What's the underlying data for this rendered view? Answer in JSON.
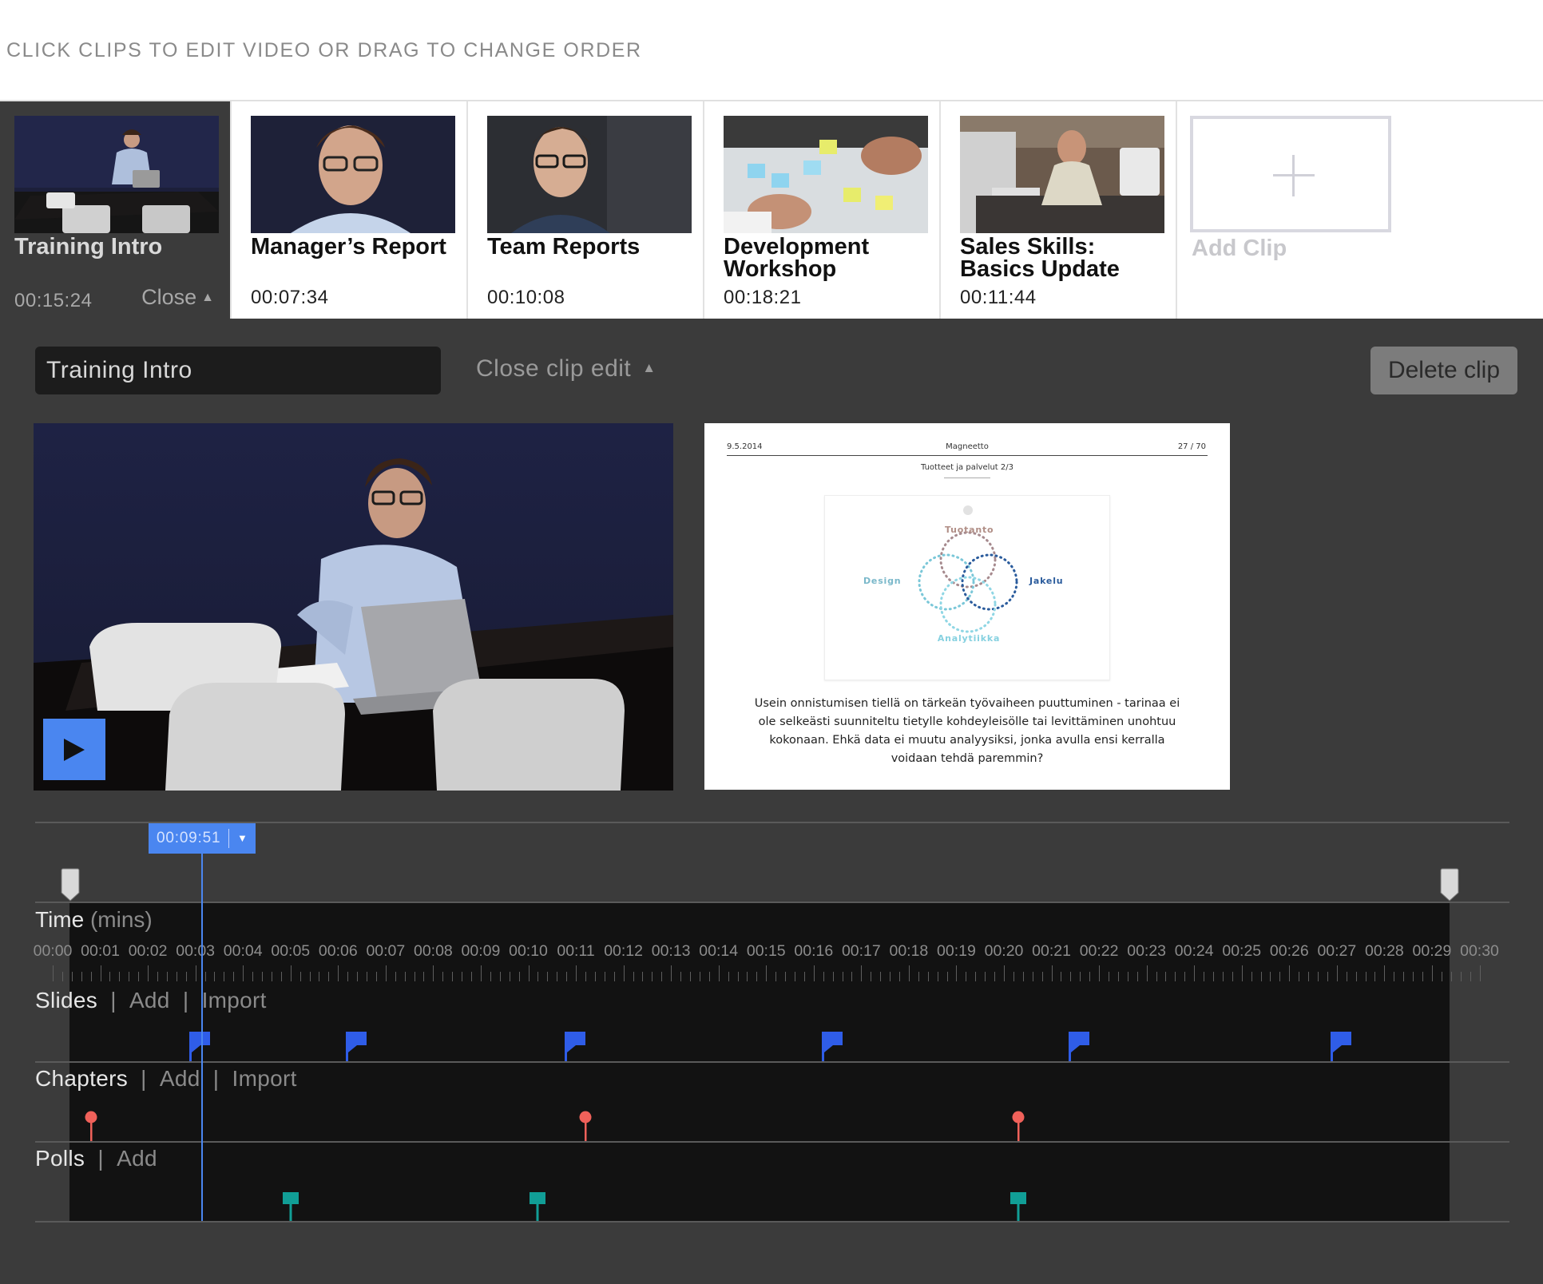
{
  "header": {
    "instruction": "CLICK CLIPS TO EDIT VIDEO OR DRAG TO CHANGE ORDER"
  },
  "clips": [
    {
      "title": "Training Intro",
      "duration": "00:15:24",
      "close_label": "Close",
      "thumb": "man-at-laptop"
    },
    {
      "title": "Manager’s Report",
      "duration": "00:07:34",
      "thumb": "man-portrait"
    },
    {
      "title": "Team Reports",
      "duration": "00:10:08",
      "thumb": "young-man"
    },
    {
      "title": "Development Workshop",
      "duration": "00:18:21",
      "thumb": "sticky-notes"
    },
    {
      "title": "Sales Skills: Basics Update",
      "duration": "00:11:44",
      "thumb": "man-at-desk"
    }
  ],
  "add_clip": {
    "label": "Add Clip",
    "icon": "plus-icon"
  },
  "editor": {
    "title_value": "Training Intro",
    "close_edit_label": "Close clip edit",
    "delete_label": "Delete clip"
  },
  "slide": {
    "date": "9.5.2014",
    "brand": "Magneetto",
    "page": "27 / 70",
    "subtitle": "Tuotteet ja palvelut 2/3",
    "venn": {
      "top": "Tuotanto",
      "left": "Design",
      "right": "Jakelu",
      "bottom": "Analytiikka"
    },
    "body": "Usein onnistumisen tiellä on tärkeän työvaiheen puuttuminen - tarinaa ei ole selkeästi suunniteltu tietylle kohdeyleisölle tai levittäminen unohtuu kokonaan. Ehkä data ei muutu analyysiksi, jonka avulla ensi kerralla voidaan tehdä paremmin?"
  },
  "timeline": {
    "playhead": "00:09:51",
    "time_label": "Time",
    "time_unit": "(mins)",
    "ticks": [
      "00:00",
      "00:01",
      "00:02",
      "00:03",
      "00:04",
      "00:05",
      "00:06",
      "00:07",
      "00:08",
      "00:09",
      "00:10",
      "00:11",
      "00:12",
      "00:13",
      "00:14",
      "00:15",
      "00:16",
      "00:17",
      "00:18",
      "00:19",
      "00:20",
      "00:21",
      "00:22",
      "00:23",
      "00:24",
      "00:25",
      "00:26",
      "00:27",
      "00:28",
      "00:29",
      "00:30"
    ],
    "slides": {
      "label": "Slides",
      "add": "Add",
      "import": "Import",
      "positions_min": [
        2.9,
        6.2,
        10.8,
        16.2,
        21.4,
        26.9
      ]
    },
    "chapters": {
      "label": "Chapters",
      "add": "Add",
      "import": "Import",
      "positions_min": [
        0.8,
        11.2,
        20.3
      ]
    },
    "polls": {
      "label": "Polls",
      "add": "Add",
      "positions_min": [
        5.0,
        10.2,
        20.3
      ]
    },
    "colors": {
      "slide": "#2f5de8",
      "chapter": "#f0615a",
      "poll": "#119e96",
      "accent": "#4a86f0"
    }
  }
}
